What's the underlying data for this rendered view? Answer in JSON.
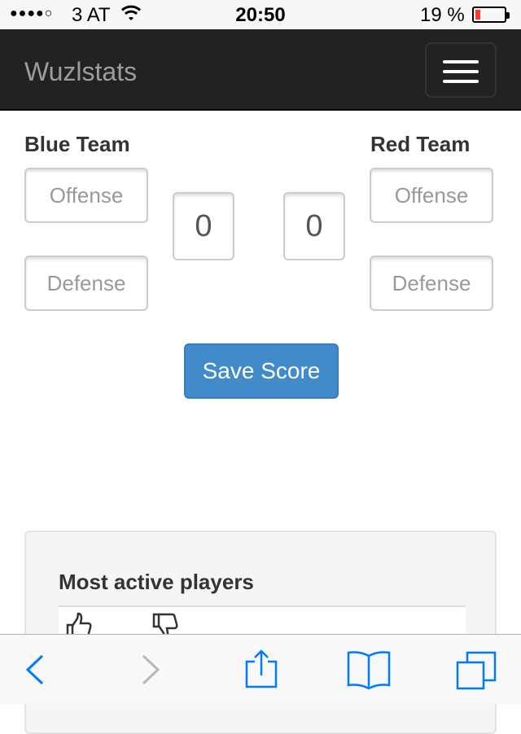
{
  "status_bar": {
    "signal": "●●●●○",
    "carrier": "3 AT",
    "time": "20:50",
    "battery_percent": "19 %",
    "battery_level": 0.19
  },
  "navbar": {
    "brand": "Wuzlstats",
    "menu_icon": "hamburger-menu-icon"
  },
  "blue_team": {
    "title": "Blue Team",
    "offense_placeholder": "Offense",
    "defense_placeholder": "Defense",
    "score": "0"
  },
  "red_team": {
    "title": "Red Team",
    "offense_placeholder": "Offense",
    "defense_placeholder": "Defense",
    "score": "0"
  },
  "actions": {
    "save_label": "Save Score"
  },
  "panel": {
    "title": "Most active players",
    "icons": [
      "thumbs-up-icon",
      "thumbs-down-icon"
    ]
  },
  "toolbar": {
    "icons": [
      "back-icon",
      "forward-icon",
      "share-icon",
      "bookmarks-icon",
      "tabs-icon"
    ]
  },
  "colors": {
    "navbar_bg": "#222222",
    "brand": "#9d9d9d",
    "primary_button": "#428bca",
    "ios_blue": "#007aff",
    "battery_low": "#ff3b30"
  }
}
